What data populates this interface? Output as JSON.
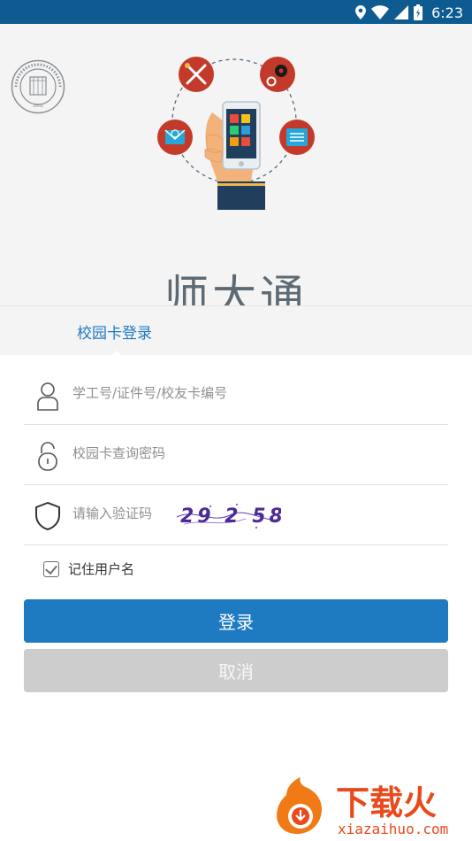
{
  "status_bar": {
    "time": "6:23",
    "icons": [
      "location-icon",
      "wifi-icon",
      "signal-icon",
      "battery-icon"
    ]
  },
  "header": {
    "logo_text": "BEIJING NORMAL UNIVERSITY",
    "logo_year": "1902",
    "app_title": "师大通"
  },
  "tabs": {
    "active_label": "校园卡登录"
  },
  "form": {
    "username_placeholder": "学工号/证件号/校友卡编号",
    "password_placeholder": "校园卡查询密码",
    "captcha_placeholder": "请输入验证码",
    "captcha_text": "29 2 58",
    "remember_label": "记住用户名",
    "remember_checked": true
  },
  "buttons": {
    "login": "登录",
    "cancel": "取消"
  },
  "watermark": {
    "brand": "下载火",
    "url": "xiazaihuo.com"
  },
  "colors": {
    "status_bar": "#0d5b91",
    "primary": "#1e7bc2",
    "cancel": "#cdcdcd",
    "title": "#5d6a73"
  }
}
